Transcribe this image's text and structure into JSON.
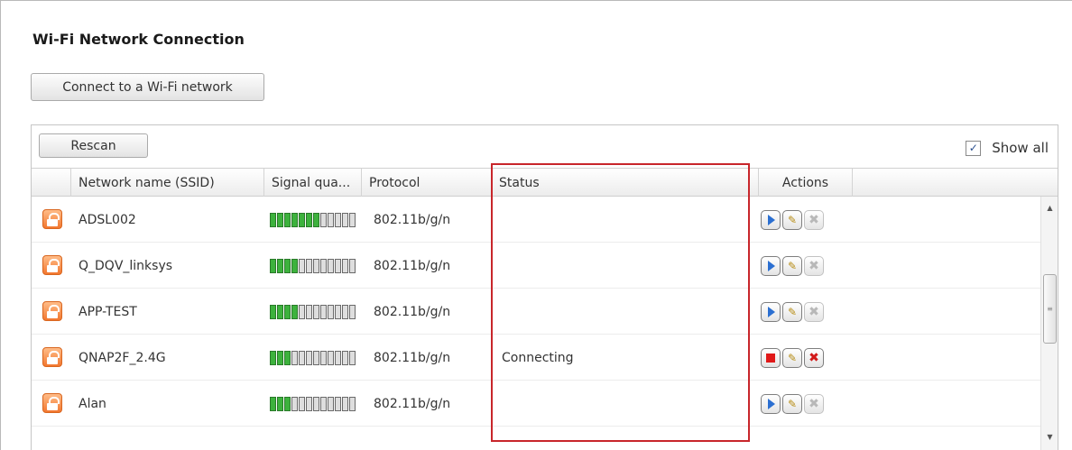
{
  "title": "Wi-Fi Network Connection",
  "connect_button": "Connect to a Wi-Fi network",
  "rescan_button": "Rescan",
  "show_all": {
    "label": "Show all",
    "checked": true,
    "check_glyph": "✓"
  },
  "columns": [
    "",
    "Network name (SSID)",
    "Signal qua...",
    "Protocol",
    "Status",
    "Actions"
  ],
  "rows": [
    {
      "ssid": "ADSL002",
      "signal_bars": 7,
      "signal_total": 12,
      "protocol": "802.11b/g/n",
      "status": "",
      "state": "idle"
    },
    {
      "ssid": "Q_DQV_linksys",
      "signal_bars": 4,
      "signal_total": 12,
      "protocol": "802.11b/g/n",
      "status": "",
      "state": "idle"
    },
    {
      "ssid": "APP-TEST",
      "signal_bars": 4,
      "signal_total": 12,
      "protocol": "802.11b/g/n",
      "status": "",
      "state": "idle"
    },
    {
      "ssid": "QNAP2F_2.4G",
      "signal_bars": 3,
      "signal_total": 12,
      "protocol": "802.11b/g/n",
      "status": "Connecting",
      "state": "connecting"
    },
    {
      "ssid": "Alan",
      "signal_bars": 3,
      "signal_total": 12,
      "protocol": "802.11b/g/n",
      "status": "",
      "state": "idle"
    }
  ],
  "icons": {
    "lock": "lock-icon",
    "connect": "play-icon",
    "stop": "stop-icon",
    "edit": "pencil-icon",
    "delete": "delete-icon",
    "edit_glyph": "✎",
    "delete_glyph": "✖",
    "scroll_up_glyph": "▲",
    "scroll_down_glyph": "▼",
    "thumb_glyph": "≡"
  },
  "colors": {
    "highlight": "#c8262b",
    "signal_on": "#3db23d",
    "lock": "#f2772f"
  }
}
